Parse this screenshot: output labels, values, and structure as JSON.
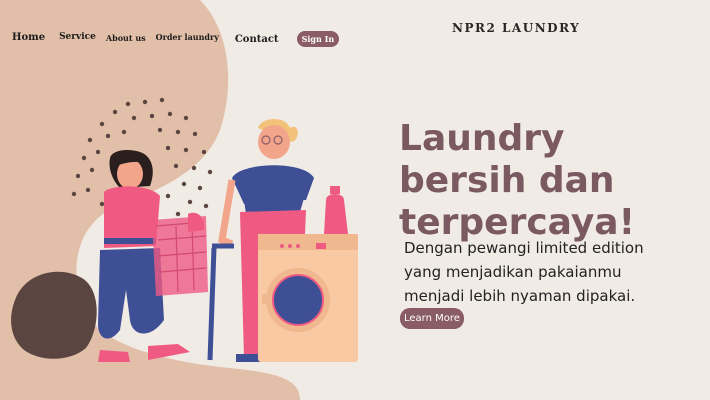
{
  "nav": {
    "home": "Home",
    "service": "Service",
    "about": "About us",
    "order": "Order laundry",
    "contact": "Contact",
    "signin": "Sign In"
  },
  "brand": "NPR2 LAUNDRY",
  "hero": {
    "headline_1": "Laundry",
    "headline_2": "bersih dan",
    "headline_3": "terpercaya!",
    "desc_1": "Dengan pewangi limited edition",
    "desc_2": "yang menjadikan pakaianmu",
    "desc_3": "menjadi lebih nyaman dipakai.",
    "cta": "Learn More"
  },
  "colors": {
    "background": "#f1ebe6",
    "blob": "#e2bfa8",
    "accent": "#8a5c66",
    "headline": "#7a5961",
    "pink": "#ef5a83",
    "navy": "#3f4f96",
    "dark_blob": "#5a4540"
  }
}
